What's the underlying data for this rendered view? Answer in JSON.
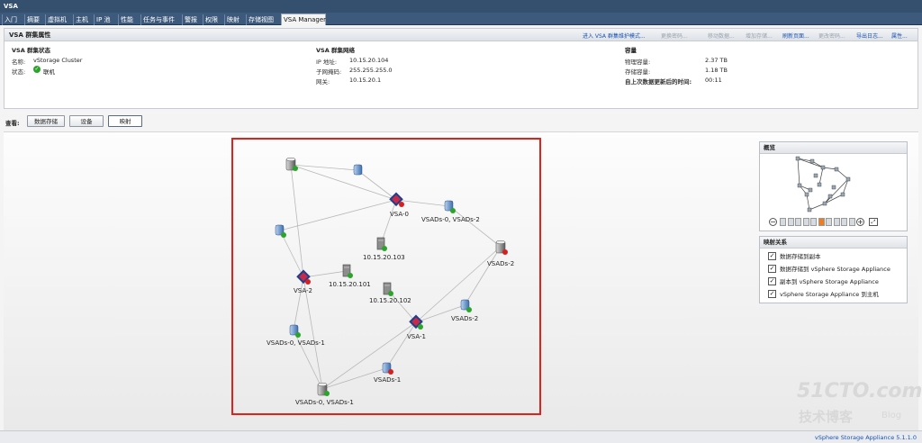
{
  "window": {
    "title": "VSA"
  },
  "tabs": [
    "入门",
    "摘要",
    "虚拟机",
    "主机",
    "IP 池",
    "性能",
    "任务与事件",
    "警报",
    "权限",
    "映射",
    "存储视图",
    "VSA Manager"
  ],
  "properties": {
    "title": "VSA 群集属性",
    "links": [
      {
        "label": "进入 VSA 群集维护模式...",
        "enabled": true
      },
      {
        "label": "更换密码...",
        "enabled": false
      },
      {
        "label": "移动数据...",
        "enabled": false
      },
      {
        "label": "增加存储...",
        "enabled": false
      },
      {
        "label": "刷新页面...",
        "enabled": true
      },
      {
        "label": "更改密码...",
        "enabled": false
      },
      {
        "label": "导出日志...",
        "enabled": true
      },
      {
        "label": "属性...",
        "enabled": true
      }
    ],
    "status": {
      "title": "VSA 群集状态",
      "name_label": "名称:",
      "name_value": "vStorage Cluster",
      "state_label": "状态:",
      "state_value": "联机"
    },
    "network": {
      "title": "VSA 群集网络",
      "ip_label": "IP 地址:",
      "ip_value": "10.15.20.104",
      "mask_label": "子网掩码:",
      "mask_value": "255.255.255.0",
      "gw_label": "网关:",
      "gw_value": "10.15.20.1"
    },
    "capacity": {
      "title": "容量",
      "physical_label": "物理容量:",
      "physical_value": "2.37 TB",
      "storage_label": "存储容量:",
      "storage_value": "1.18 TB",
      "updated_label": "自上次数据更新后的时间:",
      "updated_value": "00:11"
    }
  },
  "view": {
    "label": "查看:",
    "buttons": [
      "数据存储",
      "设备",
      "映射"
    ],
    "selected": "映射"
  },
  "graph": {
    "nodes": [
      {
        "id": "ds-top-left",
        "type": "datastore",
        "status": "ok",
        "label": ""
      },
      {
        "id": "rep-top",
        "type": "replica",
        "status": "none",
        "label": ""
      },
      {
        "id": "vsa0",
        "type": "appliance",
        "status": "error",
        "label": "VSA-0"
      },
      {
        "id": "rep-vsads02-top",
        "type": "replica",
        "status": "ok",
        "label": "VSADs-0, VSADs-2"
      },
      {
        "id": "ds-vsads2",
        "type": "datastore",
        "status": "error",
        "label": "VSADs-2"
      },
      {
        "id": "rep-left",
        "type": "replica",
        "status": "ok",
        "label": ""
      },
      {
        "id": "host103",
        "type": "host",
        "status": "ok",
        "label": "10.15.20.103"
      },
      {
        "id": "vsa2",
        "type": "appliance",
        "status": "error",
        "label": "VSA-2"
      },
      {
        "id": "host101",
        "type": "host",
        "status": "ok",
        "label": "10.15.20.101"
      },
      {
        "id": "host102",
        "type": "host",
        "status": "ok",
        "label": "10.15.20.102"
      },
      {
        "id": "rep-vsads2",
        "type": "replica",
        "status": "ok",
        "label": "VSADs-2"
      },
      {
        "id": "vsa1",
        "type": "appliance",
        "status": "ok",
        "label": "VSA-1"
      },
      {
        "id": "rep-vsads01",
        "type": "replica",
        "status": "ok",
        "label": "VSADs-0, VSADs-1"
      },
      {
        "id": "rep-vsads1",
        "type": "replica",
        "status": "error",
        "label": "VSADs-1"
      },
      {
        "id": "ds-bottom",
        "type": "datastore",
        "status": "ok",
        "label": "VSADs-0, VSADs-1"
      }
    ]
  },
  "overview": {
    "title": "概览",
    "zoom_level": 5,
    "zoom_steps": 10
  },
  "mapping": {
    "title": "映射关系",
    "items": [
      {
        "label": "数据存储到副本",
        "checked": true
      },
      {
        "label": "数据存储到 vSphere Storage Appliance",
        "checked": true
      },
      {
        "label": "副本到 vSphere Storage Appliance",
        "checked": true
      },
      {
        "label": "vSphere Storage Appliance 到主机",
        "checked": true
      }
    ]
  },
  "footer": {
    "version": "vSphere Storage Appliance 5.1.1.0"
  },
  "watermark": {
    "line1": "51CTO.com",
    "line2": "技术博客",
    "line3": "Blog"
  },
  "colors": {
    "accent": "#1a53b3",
    "highlight": "#e0211c",
    "ok": "#2aa52a",
    "error": "#d62020"
  }
}
